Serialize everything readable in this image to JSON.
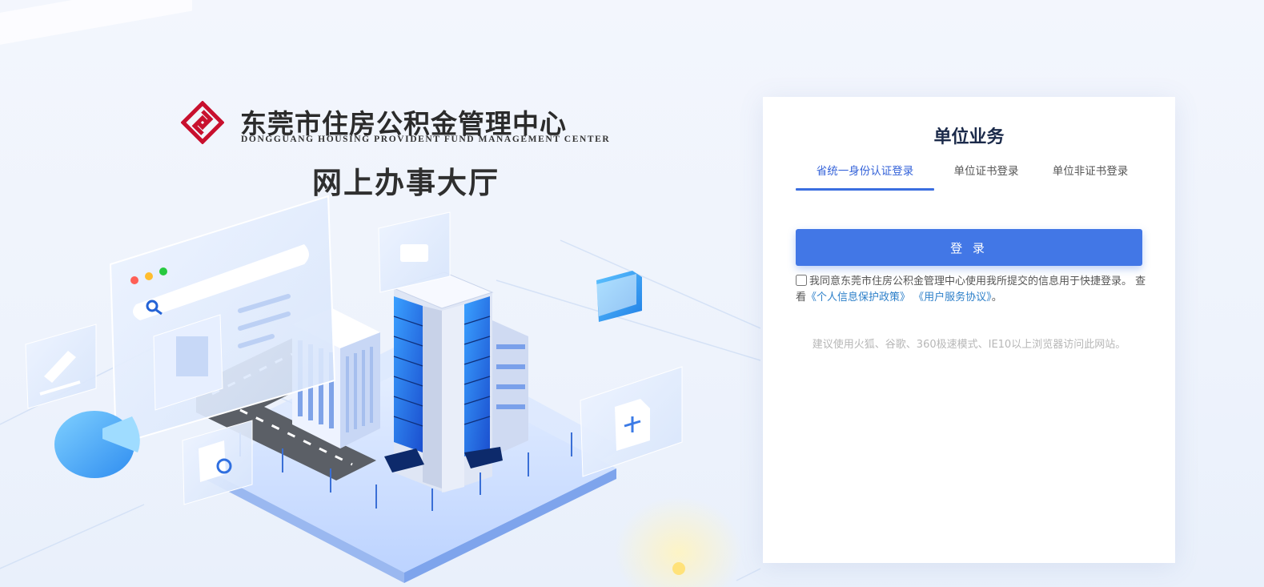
{
  "brand": {
    "name_cn": "东莞市住房公积金管理中心",
    "name_en": "DONGGUANG HOUSING PROVIDENT FUND MANAGEMENT CENTER",
    "hall_title": "网上办事大厅",
    "logo_color": "#c8102e"
  },
  "login": {
    "title": "单位业务",
    "tabs": [
      {
        "label": "省统一身份认证登录",
        "active": true
      },
      {
        "label": "单位证书登录",
        "active": false
      },
      {
        "label": "单位非证书登录",
        "active": false
      }
    ],
    "login_button": "登 录",
    "agreement": {
      "checked": false,
      "text": "我同意东莞市住房公积金管理中心使用我所提交的信息用于快捷登录。 查看",
      "privacy_link": "《个人信息保护政策》",
      "service_link": "《用户服务协议》",
      "end": "。"
    },
    "browser_hint": "建议使用火狐、谷歌、360极速模式、IE10以上浏览器访问此网站。",
    "accent_color": "#4277e6"
  },
  "illustration": {
    "icons": [
      "browser-window-icon",
      "search-icon",
      "pen-icon",
      "pie-chart-icon",
      "folder-icon",
      "document-add-icon",
      "document-search-icon",
      "lightbulb-icon",
      "office-building-icon"
    ]
  }
}
